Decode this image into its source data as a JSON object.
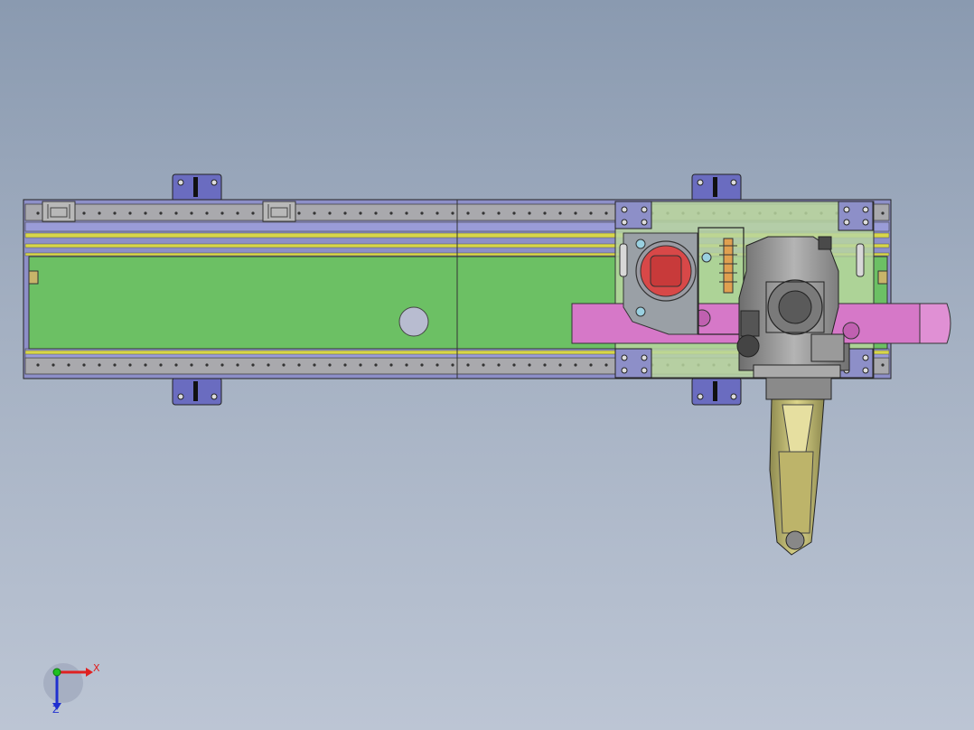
{
  "viewport": {
    "background_top": "#8a9ab0",
    "background_bottom": "#bcc5d4"
  },
  "colors": {
    "rail": "#a9a9ad",
    "rail_edge": "#55555a",
    "frame": "#8d8fc8",
    "bracket": "#6a6cc0",
    "carriage": "#b8d6a0",
    "strip": "#d8d64a",
    "panel_green": "#6cc064",
    "pink_arm": "#d678c8",
    "motor_red": "#d84848",
    "robot_gray": "#8c8c8c",
    "gripper_yellow": "#d4c870",
    "axis_x": "#e02020",
    "axis_y": "#20c020",
    "axis_z": "#2030d0"
  },
  "model": {
    "description_icon": "linear-gantry-robot-icon"
  },
  "triad": {
    "x_label": "X",
    "z_label": "Z"
  }
}
